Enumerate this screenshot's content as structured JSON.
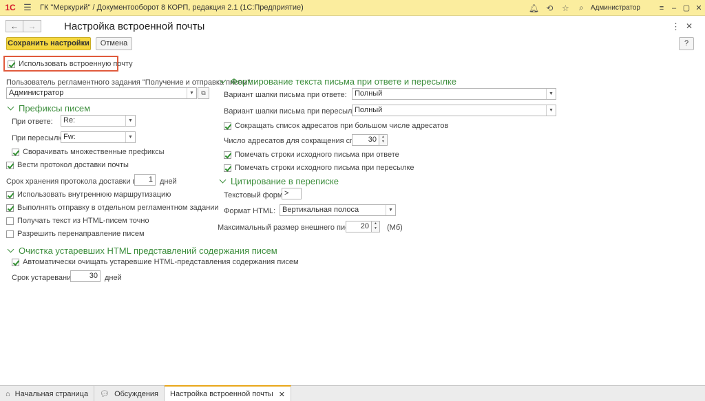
{
  "app": {
    "logo": "1С",
    "title": "ГК \"Меркурий\" / Документооборот 8 КОРП, редакция 2.1  (1С:Предприятие)",
    "user": "Администратор"
  },
  "form": {
    "title": "Настройка встроенной почты",
    "save_label": "Сохранить настройки",
    "cancel_label": "Отмена",
    "help_label": "?"
  },
  "left": {
    "use_builtin": {
      "label": "Использовать встроенную почту",
      "checked": true
    },
    "job_user_label": "Пользователь регламентного задания \"Получение и отправка писем\":",
    "job_user_value": "Администратор",
    "prefixes_section": "Префиксы писем",
    "reply_label": "При ответе:",
    "reply_value": "Re:",
    "forward_label": "При пересылке:",
    "forward_value": "Fw:",
    "collapse_prefixes": {
      "label": "Сворачивать множественные префиксы",
      "checked": true
    },
    "delivery_log": {
      "label": "Вести протокол доставки почты",
      "checked": true
    },
    "log_retention_label": "Срок хранения протокола доставки почты:",
    "log_retention_value": "1",
    "log_retention_unit": "дней",
    "internal_routing": {
      "label": "Использовать внутреннюю маршрутизацию",
      "checked": true
    },
    "separate_job": {
      "label": "Выполнять отправку в отдельном регламентном задании",
      "checked": true
    },
    "html_exact": {
      "label": "Получать текст из HTML-писем точно",
      "checked": false
    },
    "allow_redirect": {
      "label": "Разрешить перенаправление писем",
      "checked": false
    },
    "cleanup_section": "Очистка устаревших HTML представлений содержания писем",
    "auto_cleanup": {
      "label": "Автоматически очищать устаревшие HTML-представления содержания писем",
      "checked": true
    },
    "expiry_label": "Срок устаревания",
    "expiry_value": "30",
    "expiry_unit": "дней"
  },
  "right": {
    "text_section": "Формирование текста письма при ответе и пересылке",
    "reply_header_label": "Вариант шапки письма при ответе:",
    "reply_header_value": "Полный",
    "forward_header_label": "Вариант шапки письма при пересылке:",
    "forward_header_value": "Полный",
    "shorten_list": {
      "label": "Сокращать список адресатов при большом числе адресатов",
      "checked": true
    },
    "shorten_count_label": "Число адресатов для сокращения списка:",
    "shorten_count_value": "30",
    "mark_reply": {
      "label": "Помечать строки исходного письма при ответе",
      "checked": true
    },
    "mark_forward": {
      "label": "Помечать строки исходного письма при пересылке",
      "checked": true
    },
    "quote_section": "Цитирование в переписке",
    "text_format_label": "Текстовый формат:",
    "text_format_value": ">",
    "html_format_label": "Формат HTML:",
    "html_format_value": "Вертикальная полоса",
    "max_size_label": "Максимальный размер внешнего письма:",
    "max_size_value": "20",
    "max_size_unit": "(Мб)"
  },
  "tabs": [
    {
      "label": "Начальная страница",
      "icon": "home-icon"
    },
    {
      "label": "Обсуждения",
      "icon": "chat-icon"
    },
    {
      "label": "Настройка встроенной почты",
      "icon": "",
      "active": true
    }
  ],
  "colors": {
    "accent": "#f5d73f",
    "section": "#3d8e3d",
    "titlebar": "#fbed9e",
    "highlight": "#e05a3c"
  }
}
